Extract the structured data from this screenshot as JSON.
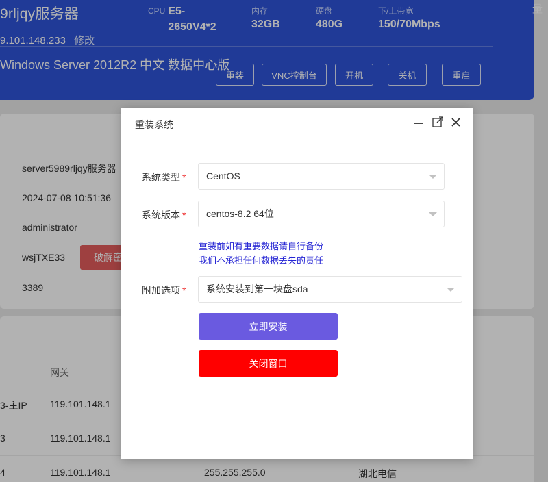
{
  "server": {
    "name": "9rljqy服务器",
    "ip": "9.101.148.233",
    "edit_label": "修改",
    "os": "Windows Server 2012R2 中文 数据中心版",
    "corner_char": "量",
    "specs": {
      "cpu_label": "CPU",
      "cpu_value_line1": "E5-",
      "cpu_value_line2": "2650V4*2",
      "memory_label": "内存",
      "memory_value": "32GB",
      "disk_label": "硬盘",
      "disk_value": "480G",
      "bandwidth_label": "下/上带宽",
      "bandwidth_value": "150/70Mbps"
    },
    "actions": {
      "reinstall": "重装",
      "vnc": "VNC控制台",
      "power_on": "开机",
      "power_off": "关机",
      "reboot": "重启"
    }
  },
  "info": {
    "hostname": "server5989rljqy服务器",
    "created": "2024-07-08 10:51:36",
    "username": "administrator",
    "password": "wsjTXE33",
    "crack_button": "破解密",
    "port": "3389"
  },
  "ip_table": {
    "gateway_header": "网关",
    "rows": [
      {
        "ip_suffix": "3-主IP",
        "gateway": "119.101.148.1",
        "mask": "",
        "line": ""
      },
      {
        "ip_suffix": "3",
        "gateway": "119.101.148.1",
        "mask": "",
        "line": ""
      },
      {
        "ip_suffix": "4",
        "gateway": "119.101.148.1",
        "mask": "255.255.255.0",
        "line": "湖北电信"
      }
    ]
  },
  "dialog": {
    "title": "重装系统",
    "system_type_label": "系统类型",
    "system_type_value": "CentOS",
    "system_version_label": "系统版本",
    "system_version_value": "centos-8.2 64位",
    "warning_line1": "重装前如有重要数据请自行备份",
    "warning_line2": "我们不承担任何数据丢失的责任",
    "extra_option_label": "附加选项",
    "extra_option_value": "系统安装到第一块盘sda",
    "required_mark": "*",
    "install_button": "立即安装",
    "close_button": "关闭窗口"
  },
  "colors": {
    "header_bg": "#2f54d8",
    "install_btn": "#6a5ae0",
    "close_btn": "#ff0000",
    "crack_btn": "#e35c5c",
    "warning_text": "#2525d4"
  }
}
